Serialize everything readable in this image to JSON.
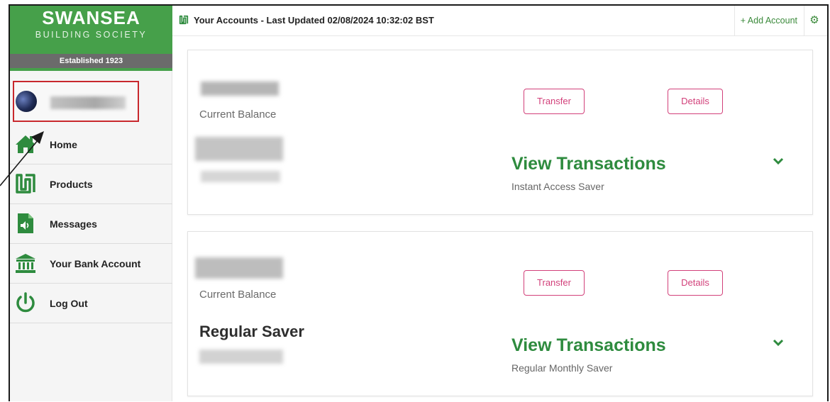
{
  "brand": {
    "name": "SWANSEA",
    "sub": "BUILDING SOCIETY",
    "established": "Established 1923"
  },
  "sidebar": {
    "items": [
      {
        "label": "Home",
        "icon": "home-icon"
      },
      {
        "label": "Products",
        "icon": "products-icon"
      },
      {
        "label": "Messages",
        "icon": "messages-icon"
      },
      {
        "label": "Your Bank Account",
        "icon": "bank-icon"
      },
      {
        "label": "Log Out",
        "icon": "power-icon"
      }
    ]
  },
  "header": {
    "title": "Your Accounts - Last Updated 02/08/2024 10:32:02 BST",
    "add_account": "+ Add Account",
    "settings_icon": "gear-icon"
  },
  "accounts": [
    {
      "balance_label": "Current Balance",
      "product_name": "",
      "transfer_label": "Transfer",
      "details_label": "Details",
      "view_transactions": "View Transactions",
      "account_type": "Instant Access Saver"
    },
    {
      "balance_label": "Current Balance",
      "product_name": "Regular Saver",
      "transfer_label": "Transfer",
      "details_label": "Details",
      "view_transactions": "View Transactions",
      "account_type": "Regular Monthly Saver"
    }
  ],
  "colors": {
    "brand_green": "#46a04a",
    "link_green": "#2e8b3e",
    "button_pink": "#d2407a",
    "highlight_red": "#c8282d"
  }
}
